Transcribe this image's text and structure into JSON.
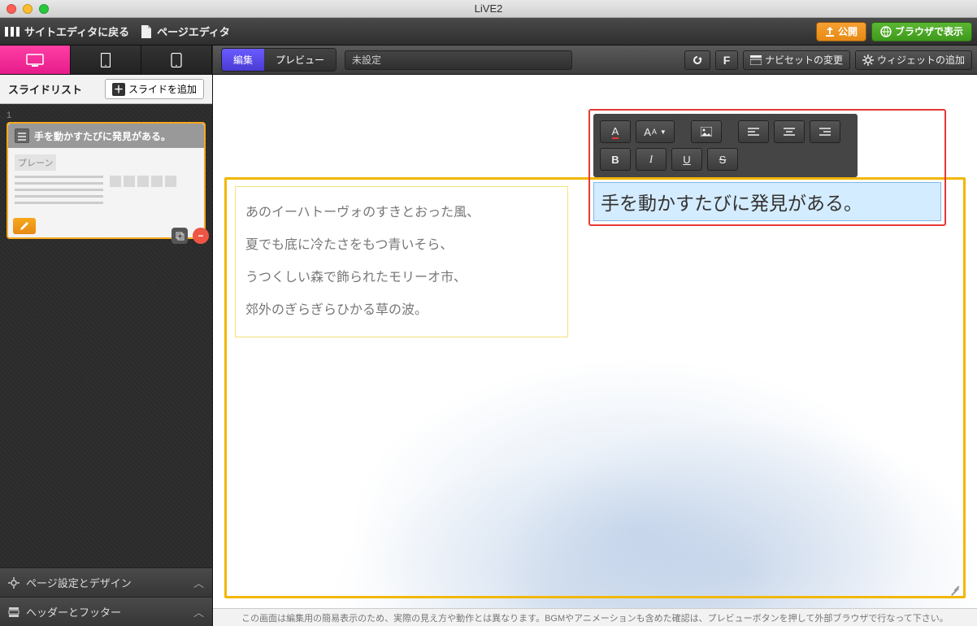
{
  "window": {
    "title": "LiVE2"
  },
  "nav": {
    "back": "サイトエディタに戻る",
    "section": "ページエディタ",
    "publish": "公開",
    "browser": "ブラウザで表示"
  },
  "toolbar": {
    "mode_edit": "編集",
    "mode_preview": "プレビュー",
    "page_title": "未設定",
    "f_button": "F",
    "naviset": "ナビセットの変更",
    "widget_add": "ウィジェットの追加"
  },
  "sidebar": {
    "list_title": "スライドリスト",
    "add_slide": "スライドを追加",
    "slide_number": "1",
    "slide_title": "手を動かすたびに発見がある。",
    "plain_label": "プレーン",
    "page_settings": "ページ設定とデザイン",
    "header_footer": "ヘッダーとフッター"
  },
  "canvas": {
    "text_lines": [
      "あのイーハトーヴォのすきとおった風、",
      "夏でも底に冷たさをもつ青いそら、",
      "うつくしい森で飾られたモリーオ市、",
      "郊外のぎらぎらひかる草の波。"
    ],
    "heading": "手を動かすたびに発見がある。"
  },
  "text_toolbar": {
    "font_color": "A",
    "font_size": "A",
    "font_size_sub": "A",
    "bold": "B",
    "italic": "I",
    "underline": "U",
    "strike": "S"
  },
  "footer": {
    "text": "この画面は編集用の簡易表示のため、実際の見え方や動作とは異なります。BGMやアニメーションも含めた確認は、プレビューボタンを押して外部ブラウザで行なって下さい。"
  }
}
